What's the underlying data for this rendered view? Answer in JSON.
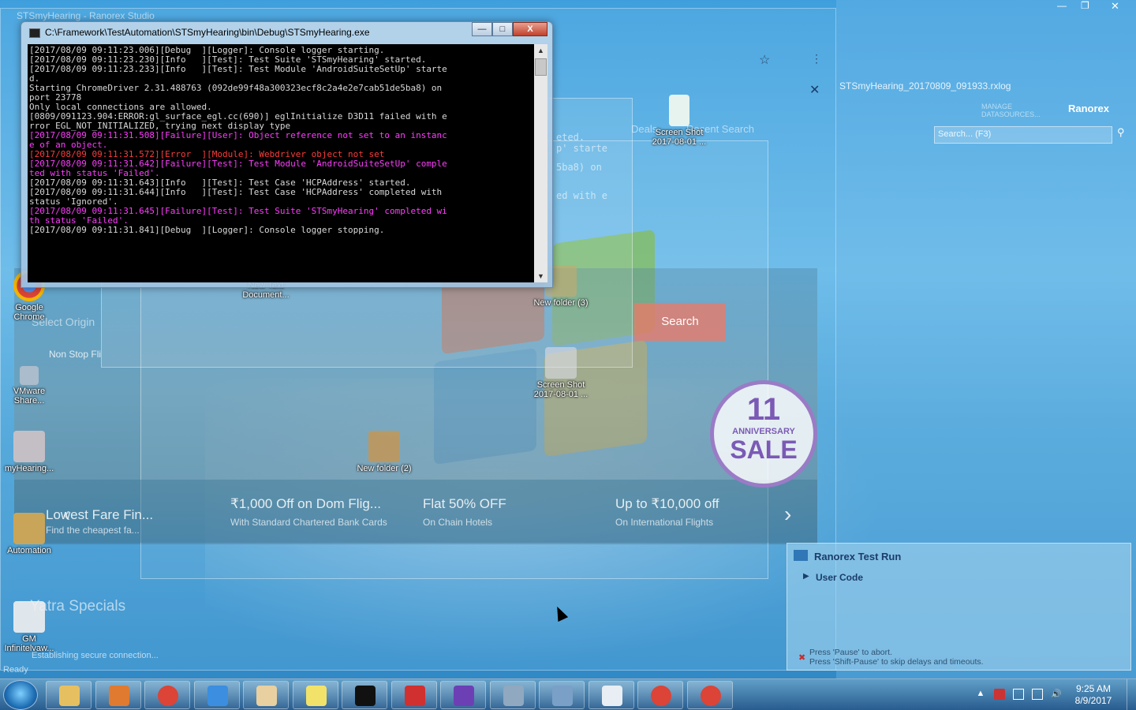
{
  "console": {
    "title": "C:\\Framework\\TestAutomation\\STSmyHearing\\bin\\Debug\\STSmyHearing.exe",
    "min": "—",
    "max": "□",
    "close": "X",
    "lines": [
      {
        "text": "[2017/08/09 09:11:23.006][Debug  ][Logger]: Console logger starting.",
        "color": "white"
      },
      {
        "text": "[2017/08/09 09:11:23.230][Info   ][Test]: Test Suite 'STSmyHearing' started.",
        "color": "white"
      },
      {
        "text": "[2017/08/09 09:11:23.233][Info   ][Test]: Test Module 'AndroidSuiteSetUp' starte",
        "color": "white"
      },
      {
        "text": "d.",
        "color": "white"
      },
      {
        "text": "Starting ChromeDriver 2.31.488763 (092de99f48a300323ecf8c2a4e2e7cab51de5ba8) on",
        "color": "white"
      },
      {
        "text": "port 23778",
        "color": "white"
      },
      {
        "text": "Only local connections are allowed.",
        "color": "white"
      },
      {
        "text": "[0809/091123.904:ERROR:gl_surface_egl.cc(690)] eglInitialize D3D11 failed with e",
        "color": "white"
      },
      {
        "text": "rror EGL_NOT_INITIALIZED, trying next display type",
        "color": "white"
      },
      {
        "text": "[2017/08/09 09:11:31.508][Failure][User]: Object reference not set to an instanc",
        "color": "mag"
      },
      {
        "text": "e of an object.",
        "color": "mag"
      },
      {
        "text": "[2017/08/09 09:11:31.572][Error  ][Module]: Webdriver object not set",
        "color": "red"
      },
      {
        "text": "[2017/08/09 09:11:31.642][Failure][Test]: Test Module 'AndroidSuiteSetUp' comple",
        "color": "mag"
      },
      {
        "text": "ted with status 'Failed'.",
        "color": "mag"
      },
      {
        "text": "[2017/08/09 09:11:31.643][Info   ][Test]: Test Case 'HCPAddress' started.",
        "color": "white"
      },
      {
        "text": "[2017/08/09 09:11:31.644][Info   ][Test]: Test Case 'HCPAddress' completed with",
        "color": "white"
      },
      {
        "text": "status 'Ignored'.",
        "color": "white"
      },
      {
        "text": "[2017/08/09 09:11:31.645][Failure][Test]: Test Suite 'STSmyHearing' completed wi",
        "color": "mag"
      },
      {
        "text": "th status 'Failed'.",
        "color": "mag"
      },
      {
        "text": "[2017/08/09 09:11:31.841][Debug  ][Logger]: Console logger stopping.",
        "color": "white"
      }
    ]
  },
  "background_browser": {
    "offers": [
      {
        "title": "Lowest Fare Fin...",
        "sub": "Find the cheapest fa..."
      },
      {
        "title": "₹1,000 Off on Dom Flig...",
        "sub": "With Standard Chartered Bank Cards"
      },
      {
        "title": "Flat 50% OFF",
        "sub": "On Chain Hotels"
      },
      {
        "title": "Up to ₹10,000 off",
        "sub": "On International Flights"
      }
    ],
    "search_label": "Search",
    "select_origin": "Select Origin",
    "non_stop": "Non Stop Fli",
    "deals": "Deals",
    "recent_search": "Recent Search",
    "yatra_specials": "Yatra Specials",
    "status_text": "Establishing secure connection...",
    "sale": {
      "number": "11",
      "line1": "ANNIVERSARY",
      "line2": "SALE"
    },
    "ghost_text_1": "eted.",
    "ghost_text_2": "p' starte",
    "ghost_text_3": "5ba8) on",
    "ghost_text_4": "ed with e"
  },
  "desktop_icons": [
    {
      "label": "Google Chrome"
    },
    {
      "label": "VMware Share..."
    },
    {
      "label": "myHearing..."
    },
    {
      "label": "Automation"
    },
    {
      "label": "GM Infinitelvaw..."
    },
    {
      "label": "New Text Document..."
    },
    {
      "label": "New folder (3)"
    },
    {
      "label": "Screen Shot 2017-08-01 ..."
    },
    {
      "label": "New folder (2)"
    },
    {
      "label": "Screen Shot 2017-08-01 ..."
    }
  ],
  "ranorex": {
    "log_tab": "STSmyHearing_20170809_091933.rxlog",
    "logo": "Ranorex",
    "manage": "MANAGE DATASOURCES...",
    "search_placeholder": "Search... (F3)",
    "testrun_title": "Ranorex Test Run",
    "user_code": "User Code",
    "hint_1": "Press 'Pause' to abort.",
    "hint_2": "Press 'Shift-Pause' to skip delays and timeouts."
  },
  "taskbar": {
    "time": "9:25 AM",
    "date": "8/9/2017",
    "items": [
      "explorer-icon",
      "media-player-icon",
      "chrome-icon",
      "internet-explorer-icon",
      "paint-icon",
      "sticky-notes-icon",
      "cmd-icon",
      "ranorex-spy-icon",
      "visual-studio-icon",
      "settings-icon",
      "network-icon",
      "ranorex-studio-icon",
      "chrome-icon",
      "chrome-icon"
    ]
  },
  "colors": {
    "console_bg": "#000000",
    "failure": "#ff3cff",
    "error": "#ff3b3b",
    "info": "#d8d8d8"
  },
  "ghost_title": "STSmyHearing - Ranorex Studio",
  "status_ready": "Ready"
}
